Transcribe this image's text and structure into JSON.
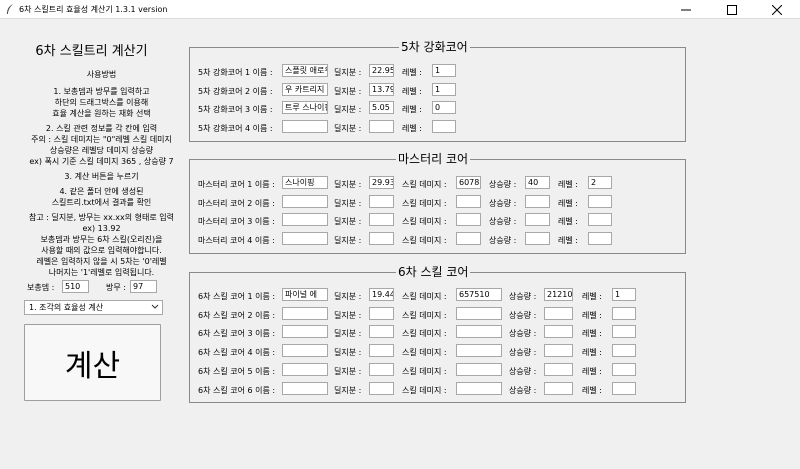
{
  "window": {
    "title": "6차 스킬트리 효율성 계산기 1.3.1 version"
  },
  "left": {
    "app_title": "6차 스킬트리 계산기",
    "help_lines": [
      "사용방법",
      "1. 보총뎀과 방무를 입력하고",
      "하단의 드래그박스를 이용해",
      "효율 계산을 원하는 재화 선택",
      "2. 스킬 관련 정보를 각 칸에 입력",
      "주의 : 스킬 데미지는 \"0\"레벨 스킬 데미지",
      "상승량은 레벨당 데미지 상승량",
      "ex) 폭시 기준 스킬 데미지 365 , 상승량 7",
      "3. 계산 버튼을 누르기",
      "4. 같은 폴더 안에 생성된",
      "스킬트리.txt에서 결과를 확인",
      "참고 : 딜지분, 방무는 xx.xx의 형태로 입력",
      "ex) 13.92",
      "보총뎀과 방무는 6차 스킬(오리진)을",
      "사용할 때의 값으로 입력해야합니다.",
      "레벨은 입력하지 않을 시 5차는 '0'레벨",
      "나머지는 '1'레벨로 입력됩니다."
    ],
    "boss_damage_label": "보총뎀 :",
    "boss_damage_value": "510",
    "ignore_def_label": "방무 :",
    "ignore_def_value": "97",
    "mode_selected": "1. 조각의 효율성 계산",
    "calc_label": "계산"
  },
  "fifth": {
    "title": "5차 강화코어",
    "name_label_1": "5차 강화코어 1  이름 :",
    "name_label_2": "5차 강화코어 2  이름 :",
    "name_label_3": "5차 강화코어 3  이름 :",
    "name_label_4": "5차 강화코어 4  이름 :",
    "share_label": "딜지분 :",
    "level_label": "레벨 :",
    "rows": [
      {
        "name": "스플릿 애로우",
        "share": "22.95",
        "level": "1"
      },
      {
        "name": "우 카트리지",
        "share": "13.79",
        "level": "1"
      },
      {
        "name": "트루 스나이핑",
        "share": "5.05",
        "level": "0"
      },
      {
        "name": "",
        "share": "",
        "level": ""
      }
    ]
  },
  "mastery": {
    "title": "마스터리 코어",
    "name_label_1": "마스터리 코어 1  이름 :",
    "name_label_2": "마스터리 코어 2  이름 :",
    "name_label_3": "마스터리 코어 3  이름 :",
    "name_label_4": "마스터리 코어 4  이름 :",
    "share_label": "딜지분 :",
    "damage_label": "스킬 데미지 :",
    "increase_label": "상승량 :",
    "level_label": "레벨 :",
    "rows": [
      {
        "name": "스나이핑",
        "share": "29.93",
        "damage": "6078",
        "increase": "40",
        "level": "2"
      },
      {
        "name": "",
        "share": "",
        "damage": "",
        "increase": "",
        "level": ""
      },
      {
        "name": "",
        "share": "",
        "damage": "",
        "increase": "",
        "level": ""
      },
      {
        "name": "",
        "share": "",
        "damage": "",
        "increase": "",
        "level": ""
      }
    ]
  },
  "sixth": {
    "title": "6차 스킬 코어",
    "name_label_1": "6차 스킬 코어 1  이름 :",
    "name_label_2": "6차 스킬 코어 2  이름 :",
    "name_label_3": "6차 스킬 코어 3  이름 :",
    "name_label_4": "6차 스킬 코어 4  이름 :",
    "name_label_5": "6차 스킬 코어 5  이름 :",
    "name_label_6": "6차 스킬 코어 6  이름 :",
    "share_label": "딜지분 :",
    "damage_label": "스킬 데미지 :",
    "increase_label": "상승량 :",
    "level_label": "레벨 :",
    "rows": [
      {
        "name": "파이널 에",
        "share": "19.44",
        "damage": "657510",
        "increase": "21210",
        "level": "1"
      },
      {
        "name": "",
        "share": "",
        "damage": "",
        "increase": "",
        "level": ""
      },
      {
        "name": "",
        "share": "",
        "damage": "",
        "increase": "",
        "level": ""
      },
      {
        "name": "",
        "share": "",
        "damage": "",
        "increase": "",
        "level": ""
      },
      {
        "name": "",
        "share": "",
        "damage": "",
        "increase": "",
        "level": ""
      },
      {
        "name": "",
        "share": "",
        "damage": "",
        "increase": "",
        "level": ""
      }
    ]
  }
}
